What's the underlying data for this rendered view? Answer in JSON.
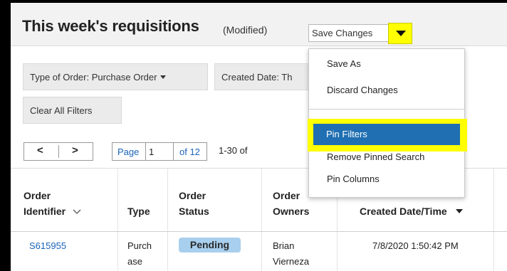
{
  "header": {
    "title": "This week's requisitions",
    "modified_label": "(Modified)",
    "save_button_label": "Save Changes"
  },
  "filters": {
    "chips": [
      {
        "label": "Type of Order: Purchase Order"
      },
      {
        "label": "Created Date: Th"
      }
    ],
    "clear_label": "Clear All Filters"
  },
  "pager": {
    "prev_glyph": "<",
    "next_glyph": ">",
    "page_label": "Page",
    "current_page": "1",
    "of_label": "of 12",
    "range_label": "1-30 of"
  },
  "table": {
    "headers": {
      "order_identifier": [
        "Order",
        "Identifier"
      ],
      "type": "Type",
      "order_status": [
        "Order",
        "Status"
      ],
      "order_owners": [
        "Order",
        "Owners"
      ],
      "created": "Created Date/Time"
    },
    "rows": [
      {
        "order_identifier": "S615955",
        "type": [
          "Purch",
          "ase"
        ],
        "status": "Pending",
        "owners": [
          "Brian",
          "Vierneza"
        ],
        "created": "7/8/2020 1:50:42 PM"
      }
    ]
  },
  "menu": {
    "items": [
      {
        "label": "Save As"
      },
      {
        "label": "Discard Changes"
      },
      {
        "label": "Pin Filters"
      },
      {
        "label": "Remove Pinned Search"
      },
      {
        "label": "Pin Columns"
      }
    ]
  },
  "colors": {
    "highlight": "#ffff00",
    "menu_active": "#1f6fb2",
    "status_badge": "#a8cfee",
    "link": "#1a63b8"
  }
}
